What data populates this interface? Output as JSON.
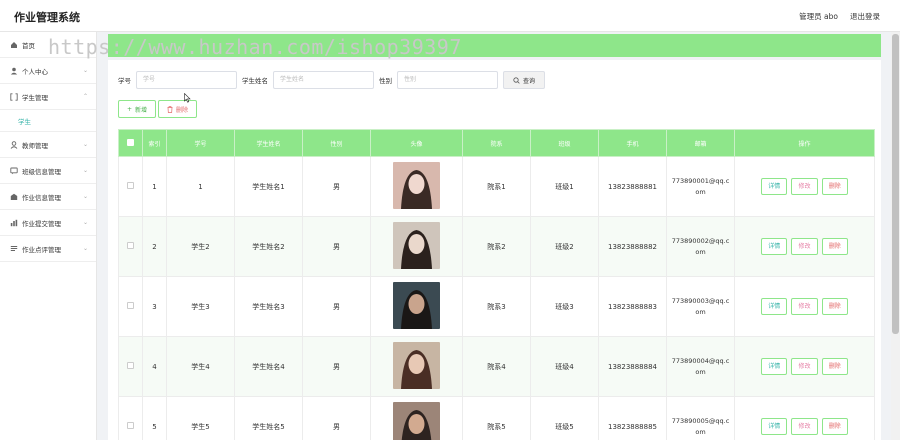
{
  "app": {
    "title": "作业管理系统"
  },
  "header": {
    "user_label": "管理员 abo",
    "logout_label": "退出登录"
  },
  "watermark": "https://www.huzhan.com/ishop39397",
  "sidebar": {
    "items": [
      {
        "label": "首页",
        "icon": "home-icon"
      },
      {
        "label": "个人中心",
        "icon": "user-icon"
      },
      {
        "label": "学生管理",
        "icon": "bracket-icon",
        "sub": "学生"
      },
      {
        "label": "教师管理",
        "icon": "person-icon"
      },
      {
        "label": "班级信息管理",
        "icon": "chat-icon"
      },
      {
        "label": "作业信息管理",
        "icon": "book-icon"
      },
      {
        "label": "作业提交管理",
        "icon": "chart-icon"
      },
      {
        "label": "作业点评管理",
        "icon": "comment-icon"
      }
    ]
  },
  "search": {
    "fields": [
      {
        "label": "学号",
        "placeholder": "学号"
      },
      {
        "label": "学生姓名",
        "placeholder": "学生姓名"
      },
      {
        "label": "性别",
        "placeholder": "性别"
      }
    ],
    "button_label": "查询"
  },
  "actions": {
    "add_label": "新增",
    "delete_label": "删除"
  },
  "table": {
    "headers": [
      "",
      "索引",
      "学号",
      "学生姓名",
      "性别",
      "头像",
      "院系",
      "班级",
      "手机",
      "邮箱",
      "操作"
    ],
    "rows": [
      {
        "index": "1",
        "id": "1",
        "name": "学生姓名1",
        "gender": "男",
        "dept": "院系1",
        "cls": "班级1",
        "phone": "13823888881",
        "email": "773890001@qq.com"
      },
      {
        "index": "2",
        "id": "学生2",
        "name": "学生姓名2",
        "gender": "男",
        "dept": "院系2",
        "cls": "班级2",
        "phone": "13823888882",
        "email": "773890002@qq.com"
      },
      {
        "index": "3",
        "id": "学生3",
        "name": "学生姓名3",
        "gender": "男",
        "dept": "院系3",
        "cls": "班级3",
        "phone": "13823888883",
        "email": "773890003@qq.com"
      },
      {
        "index": "4",
        "id": "学生4",
        "name": "学生姓名4",
        "gender": "男",
        "dept": "院系4",
        "cls": "班级4",
        "phone": "13823888884",
        "email": "773890004@qq.com"
      },
      {
        "index": "5",
        "id": "学生5",
        "name": "学生姓名5",
        "gender": "男",
        "dept": "院系5",
        "cls": "班级5",
        "phone": "13823888885",
        "email": "773890005@qq.com"
      }
    ],
    "op_labels": {
      "detail": "详情",
      "edit": "修改",
      "delete": "删除"
    }
  },
  "colors": {
    "accent": "#8ee68a",
    "teal": "#34b3a8",
    "danger": "#e36b6b"
  }
}
